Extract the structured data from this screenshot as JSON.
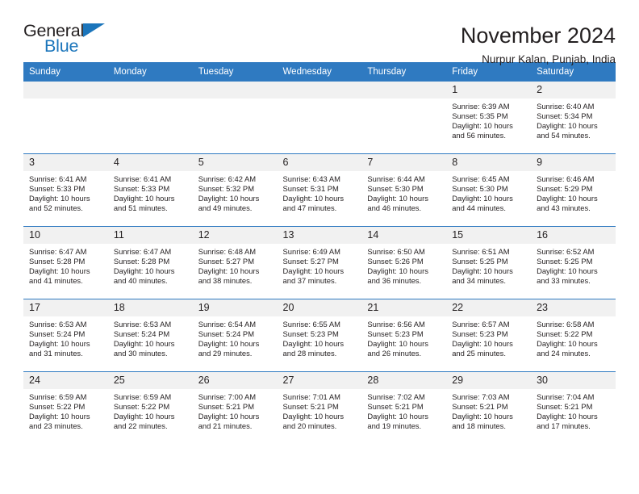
{
  "brand": {
    "name_top": "General",
    "name_bottom": "Blue",
    "triangle_icon": "brand-triangle-icon",
    "color_blue": "#1b75bb",
    "color_dark": "#231f20"
  },
  "header": {
    "month_title": "November 2024",
    "location": "Nurpur Kalan, Punjab, India"
  },
  "theme": {
    "header_blue": "#2f7ac1",
    "daynum_band": "#f1f1f1",
    "text": "#231f20"
  },
  "calendar": {
    "weekday_headers": [
      "Sunday",
      "Monday",
      "Tuesday",
      "Wednesday",
      "Thursday",
      "Friday",
      "Saturday"
    ],
    "weeks": [
      [
        {
          "day": "",
          "blank": true,
          "sunrise": "",
          "sunset": "",
          "daylight_line1": "",
          "daylight_line2": ""
        },
        {
          "day": "",
          "blank": true,
          "sunrise": "",
          "sunset": "",
          "daylight_line1": "",
          "daylight_line2": ""
        },
        {
          "day": "",
          "blank": true,
          "sunrise": "",
          "sunset": "",
          "daylight_line1": "",
          "daylight_line2": ""
        },
        {
          "day": "",
          "blank": true,
          "sunrise": "",
          "sunset": "",
          "daylight_line1": "",
          "daylight_line2": ""
        },
        {
          "day": "",
          "blank": true,
          "sunrise": "",
          "sunset": "",
          "daylight_line1": "",
          "daylight_line2": ""
        },
        {
          "day": "1",
          "sunrise": "Sunrise: 6:39 AM",
          "sunset": "Sunset: 5:35 PM",
          "daylight_line1": "Daylight: 10 hours",
          "daylight_line2": "and 56 minutes."
        },
        {
          "day": "2",
          "sunrise": "Sunrise: 6:40 AM",
          "sunset": "Sunset: 5:34 PM",
          "daylight_line1": "Daylight: 10 hours",
          "daylight_line2": "and 54 minutes."
        }
      ],
      [
        {
          "day": "3",
          "sunrise": "Sunrise: 6:41 AM",
          "sunset": "Sunset: 5:33 PM",
          "daylight_line1": "Daylight: 10 hours",
          "daylight_line2": "and 52 minutes."
        },
        {
          "day": "4",
          "sunrise": "Sunrise: 6:41 AM",
          "sunset": "Sunset: 5:33 PM",
          "daylight_line1": "Daylight: 10 hours",
          "daylight_line2": "and 51 minutes."
        },
        {
          "day": "5",
          "sunrise": "Sunrise: 6:42 AM",
          "sunset": "Sunset: 5:32 PM",
          "daylight_line1": "Daylight: 10 hours",
          "daylight_line2": "and 49 minutes."
        },
        {
          "day": "6",
          "sunrise": "Sunrise: 6:43 AM",
          "sunset": "Sunset: 5:31 PM",
          "daylight_line1": "Daylight: 10 hours",
          "daylight_line2": "and 47 minutes."
        },
        {
          "day": "7",
          "sunrise": "Sunrise: 6:44 AM",
          "sunset": "Sunset: 5:30 PM",
          "daylight_line1": "Daylight: 10 hours",
          "daylight_line2": "and 46 minutes."
        },
        {
          "day": "8",
          "sunrise": "Sunrise: 6:45 AM",
          "sunset": "Sunset: 5:30 PM",
          "daylight_line1": "Daylight: 10 hours",
          "daylight_line2": "and 44 minutes."
        },
        {
          "day": "9",
          "sunrise": "Sunrise: 6:46 AM",
          "sunset": "Sunset: 5:29 PM",
          "daylight_line1": "Daylight: 10 hours",
          "daylight_line2": "and 43 minutes."
        }
      ],
      [
        {
          "day": "10",
          "sunrise": "Sunrise: 6:47 AM",
          "sunset": "Sunset: 5:28 PM",
          "daylight_line1": "Daylight: 10 hours",
          "daylight_line2": "and 41 minutes."
        },
        {
          "day": "11",
          "sunrise": "Sunrise: 6:47 AM",
          "sunset": "Sunset: 5:28 PM",
          "daylight_line1": "Daylight: 10 hours",
          "daylight_line2": "and 40 minutes."
        },
        {
          "day": "12",
          "sunrise": "Sunrise: 6:48 AM",
          "sunset": "Sunset: 5:27 PM",
          "daylight_line1": "Daylight: 10 hours",
          "daylight_line2": "and 38 minutes."
        },
        {
          "day": "13",
          "sunrise": "Sunrise: 6:49 AM",
          "sunset": "Sunset: 5:27 PM",
          "daylight_line1": "Daylight: 10 hours",
          "daylight_line2": "and 37 minutes."
        },
        {
          "day": "14",
          "sunrise": "Sunrise: 6:50 AM",
          "sunset": "Sunset: 5:26 PM",
          "daylight_line1": "Daylight: 10 hours",
          "daylight_line2": "and 36 minutes."
        },
        {
          "day": "15",
          "sunrise": "Sunrise: 6:51 AM",
          "sunset": "Sunset: 5:25 PM",
          "daylight_line1": "Daylight: 10 hours",
          "daylight_line2": "and 34 minutes."
        },
        {
          "day": "16",
          "sunrise": "Sunrise: 6:52 AM",
          "sunset": "Sunset: 5:25 PM",
          "daylight_line1": "Daylight: 10 hours",
          "daylight_line2": "and 33 minutes."
        }
      ],
      [
        {
          "day": "17",
          "sunrise": "Sunrise: 6:53 AM",
          "sunset": "Sunset: 5:24 PM",
          "daylight_line1": "Daylight: 10 hours",
          "daylight_line2": "and 31 minutes."
        },
        {
          "day": "18",
          "sunrise": "Sunrise: 6:53 AM",
          "sunset": "Sunset: 5:24 PM",
          "daylight_line1": "Daylight: 10 hours",
          "daylight_line2": "and 30 minutes."
        },
        {
          "day": "19",
          "sunrise": "Sunrise: 6:54 AM",
          "sunset": "Sunset: 5:24 PM",
          "daylight_line1": "Daylight: 10 hours",
          "daylight_line2": "and 29 minutes."
        },
        {
          "day": "20",
          "sunrise": "Sunrise: 6:55 AM",
          "sunset": "Sunset: 5:23 PM",
          "daylight_line1": "Daylight: 10 hours",
          "daylight_line2": "and 28 minutes."
        },
        {
          "day": "21",
          "sunrise": "Sunrise: 6:56 AM",
          "sunset": "Sunset: 5:23 PM",
          "daylight_line1": "Daylight: 10 hours",
          "daylight_line2": "and 26 minutes."
        },
        {
          "day": "22",
          "sunrise": "Sunrise: 6:57 AM",
          "sunset": "Sunset: 5:23 PM",
          "daylight_line1": "Daylight: 10 hours",
          "daylight_line2": "and 25 minutes."
        },
        {
          "day": "23",
          "sunrise": "Sunrise: 6:58 AM",
          "sunset": "Sunset: 5:22 PM",
          "daylight_line1": "Daylight: 10 hours",
          "daylight_line2": "and 24 minutes."
        }
      ],
      [
        {
          "day": "24",
          "sunrise": "Sunrise: 6:59 AM",
          "sunset": "Sunset: 5:22 PM",
          "daylight_line1": "Daylight: 10 hours",
          "daylight_line2": "and 23 minutes."
        },
        {
          "day": "25",
          "sunrise": "Sunrise: 6:59 AM",
          "sunset": "Sunset: 5:22 PM",
          "daylight_line1": "Daylight: 10 hours",
          "daylight_line2": "and 22 minutes."
        },
        {
          "day": "26",
          "sunrise": "Sunrise: 7:00 AM",
          "sunset": "Sunset: 5:21 PM",
          "daylight_line1": "Daylight: 10 hours",
          "daylight_line2": "and 21 minutes."
        },
        {
          "day": "27",
          "sunrise": "Sunrise: 7:01 AM",
          "sunset": "Sunset: 5:21 PM",
          "daylight_line1": "Daylight: 10 hours",
          "daylight_line2": "and 20 minutes."
        },
        {
          "day": "28",
          "sunrise": "Sunrise: 7:02 AM",
          "sunset": "Sunset: 5:21 PM",
          "daylight_line1": "Daylight: 10 hours",
          "daylight_line2": "and 19 minutes."
        },
        {
          "day": "29",
          "sunrise": "Sunrise: 7:03 AM",
          "sunset": "Sunset: 5:21 PM",
          "daylight_line1": "Daylight: 10 hours",
          "daylight_line2": "and 18 minutes."
        },
        {
          "day": "30",
          "sunrise": "Sunrise: 7:04 AM",
          "sunset": "Sunset: 5:21 PM",
          "daylight_line1": "Daylight: 10 hours",
          "daylight_line2": "and 17 minutes."
        }
      ]
    ]
  }
}
